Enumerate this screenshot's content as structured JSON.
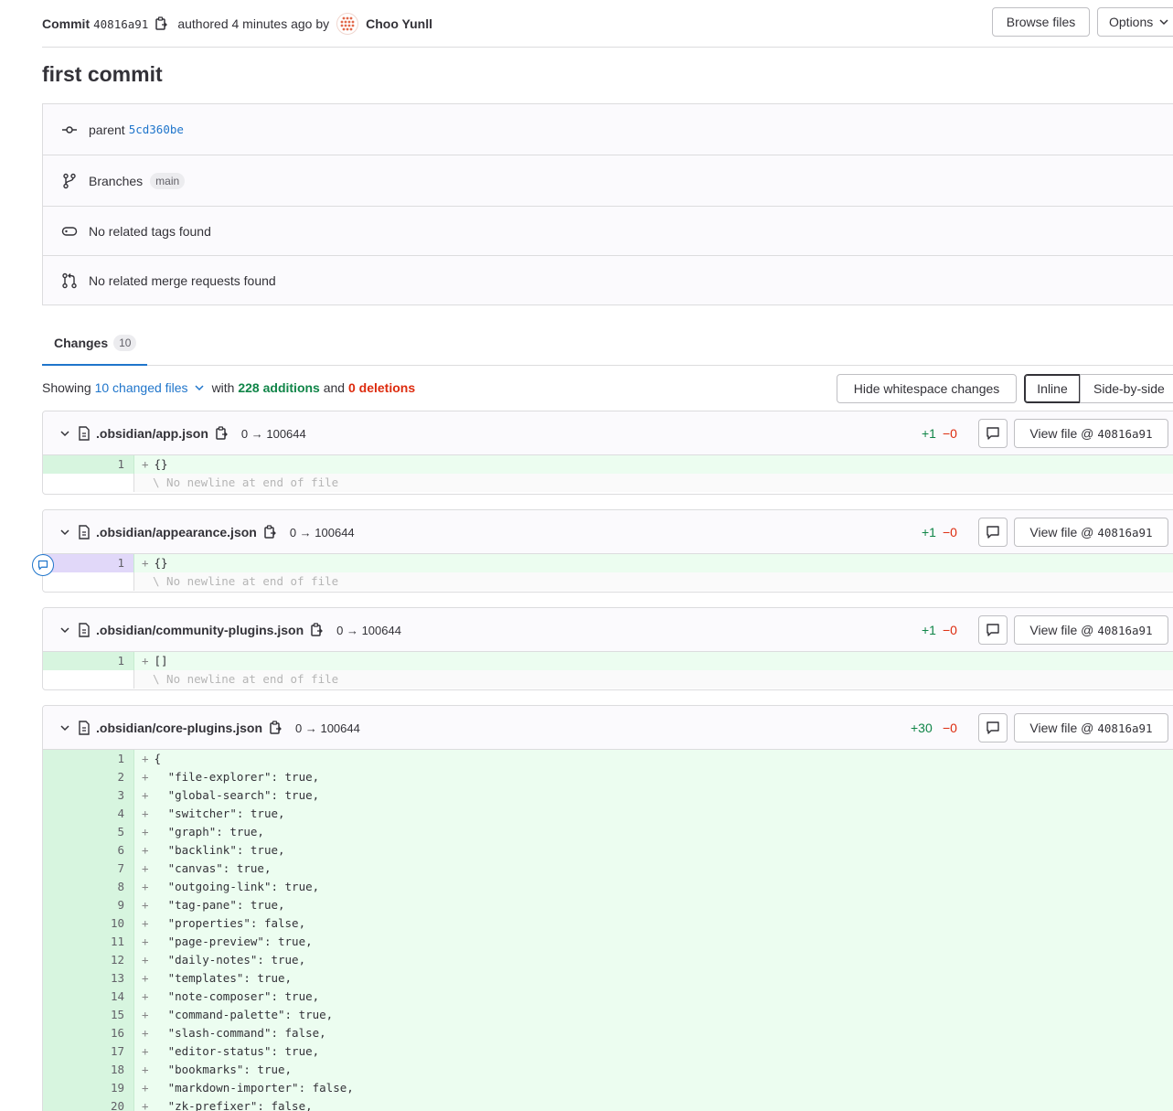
{
  "commit": {
    "label": "Commit",
    "sha": "40816a91",
    "authored_text": "authored 4 minutes ago by",
    "author": "Choo Yunll",
    "title": "first commit",
    "browse_files": "Browse files",
    "options": "Options"
  },
  "info": {
    "parent_label": "parent",
    "parent_sha": "5cd360be",
    "branches_label": "Branches",
    "branch": "main",
    "tags_text": "No related tags found",
    "mrs_text": "No related merge requests found"
  },
  "tabs": {
    "changes_label": "Changes",
    "changes_count": "10"
  },
  "summary": {
    "showing": "Showing",
    "changed_files": "10 changed files",
    "with": "with",
    "additions": "228 additions",
    "and": "and",
    "deletions": "0 deletions",
    "hide_whitespace": "Hide whitespace changes",
    "inline": "Inline",
    "side_by_side": "Side-by-side"
  },
  "files": [
    {
      "name": ".obsidian/app.json",
      "mode": "0 → 100644",
      "added": "+1",
      "removed": "−0",
      "view_label": "View file @",
      "view_sha": "40816a91",
      "lines": [
        {
          "n": "1",
          "code": "{}"
        }
      ],
      "no_newline": "\\ No newline at end of file"
    },
    {
      "name": ".obsidian/appearance.json",
      "mode": "0 → 100644",
      "added": "+1",
      "removed": "−0",
      "view_label": "View file @",
      "view_sha": "40816a91",
      "lines": [
        {
          "n": "1",
          "code": "{}"
        }
      ],
      "no_newline": "\\ No newline at end of file"
    },
    {
      "name": ".obsidian/community-plugins.json",
      "mode": "0 → 100644",
      "added": "+1",
      "removed": "−0",
      "view_label": "View file @",
      "view_sha": "40816a91",
      "lines": [
        {
          "n": "1",
          "code": "[]"
        }
      ],
      "no_newline": "\\ No newline at end of file"
    },
    {
      "name": ".obsidian/core-plugins.json",
      "mode": "0 → 100644",
      "added": "+30",
      "removed": "−0",
      "view_label": "View file @",
      "view_sha": "40816a91",
      "lines": [
        {
          "n": "1",
          "code": "{"
        },
        {
          "n": "2",
          "code": "  \"file-explorer\": true,"
        },
        {
          "n": "3",
          "code": "  \"global-search\": true,"
        },
        {
          "n": "4",
          "code": "  \"switcher\": true,"
        },
        {
          "n": "5",
          "code": "  \"graph\": true,"
        },
        {
          "n": "6",
          "code": "  \"backlink\": true,"
        },
        {
          "n": "7",
          "code": "  \"canvas\": true,"
        },
        {
          "n": "8",
          "code": "  \"outgoing-link\": true,"
        },
        {
          "n": "9",
          "code": "  \"tag-pane\": true,"
        },
        {
          "n": "10",
          "code": "  \"properties\": false,"
        },
        {
          "n": "11",
          "code": "  \"page-preview\": true,"
        },
        {
          "n": "12",
          "code": "  \"daily-notes\": true,"
        },
        {
          "n": "13",
          "code": "  \"templates\": true,"
        },
        {
          "n": "14",
          "code": "  \"note-composer\": true,"
        },
        {
          "n": "15",
          "code": "  \"command-palette\": true,"
        },
        {
          "n": "16",
          "code": "  \"slash-command\": false,"
        },
        {
          "n": "17",
          "code": "  \"editor-status\": true,"
        },
        {
          "n": "18",
          "code": "  \"bookmarks\": true,"
        },
        {
          "n": "19",
          "code": "  \"markdown-importer\": false,"
        },
        {
          "n": "20",
          "code": "  \"zk-prefixer\": false,"
        }
      ]
    }
  ]
}
